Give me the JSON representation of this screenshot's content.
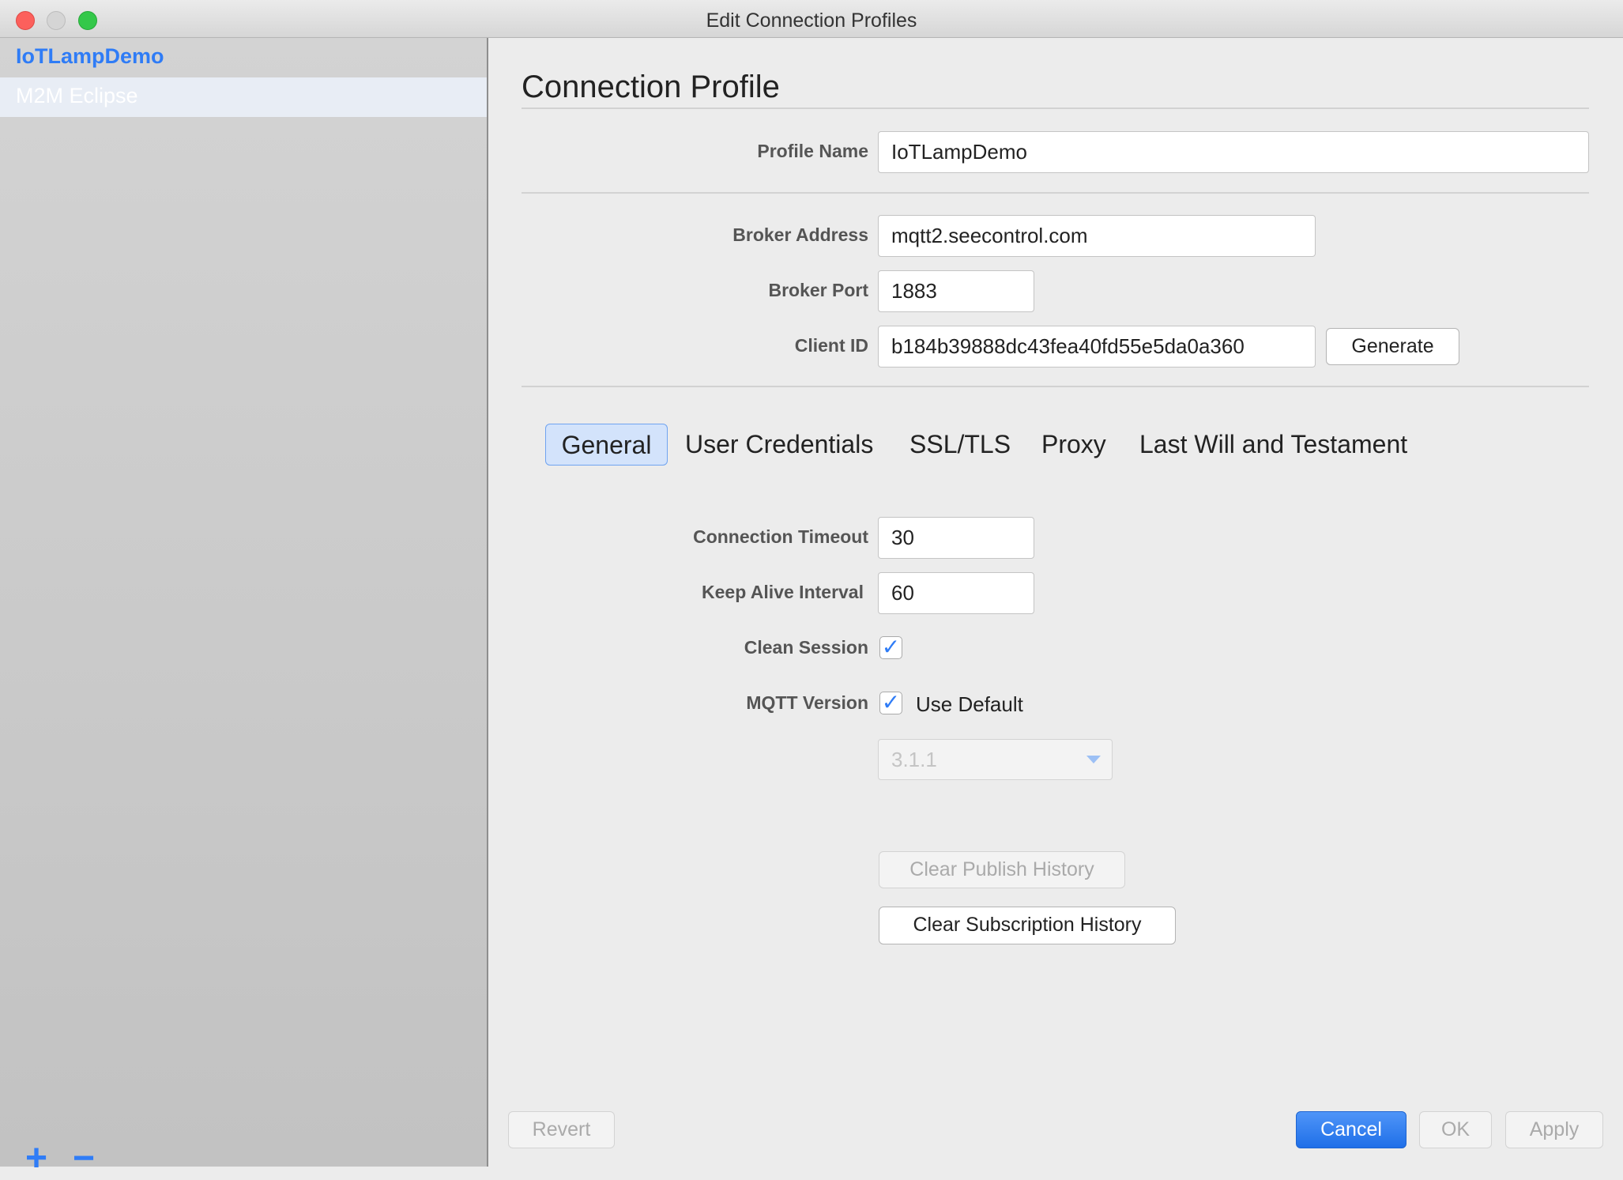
{
  "window": {
    "title": "Edit Connection Profiles"
  },
  "sidebar": {
    "items": [
      {
        "label": "IoTLampDemo",
        "selected": true
      },
      {
        "label": "M2M Eclipse"
      }
    ],
    "add": "+",
    "remove": "−"
  },
  "main": {
    "heading": "Connection Profile",
    "profile_name": {
      "label": "Profile Name",
      "value": "IoTLampDemo"
    },
    "broker_address": {
      "label": "Broker Address",
      "value": "mqtt2.seecontrol.com"
    },
    "broker_port": {
      "label": "Broker Port",
      "value": "1883"
    },
    "client_id": {
      "label": "Client ID",
      "value": "b184b39888dc43fea40fd55e5da0a360",
      "generate": "Generate"
    },
    "tabs": [
      {
        "label": "General",
        "active": true
      },
      {
        "label": "User Credentials"
      },
      {
        "label": "SSL/TLS"
      },
      {
        "label": "Proxy"
      },
      {
        "label": "Last Will and Testament"
      }
    ],
    "general": {
      "connection_timeout": {
        "label": "Connection Timeout",
        "value": "30"
      },
      "keep_alive": {
        "label": "Keep Alive Interval",
        "value": "60"
      },
      "clean_session": {
        "label": "Clean Session",
        "checked": true
      },
      "mqtt_version": {
        "label": "MQTT Version",
        "use_default_label": "Use Default",
        "use_default": true,
        "selected": "3.1.1"
      },
      "clear_publish": "Clear Publish History",
      "clear_subscription": "Clear Subscription History"
    }
  },
  "footer": {
    "revert": "Revert",
    "cancel": "Cancel",
    "ok": "OK",
    "apply": "Apply"
  },
  "colors": {
    "accent": "#2f7cf6",
    "selected_row": "#e8edf5"
  }
}
